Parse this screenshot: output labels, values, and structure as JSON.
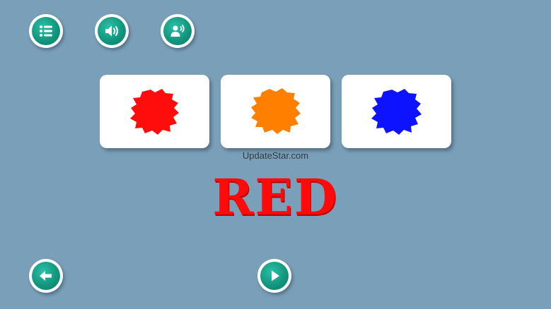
{
  "toolbar": {
    "menu_icon": "list-menu-icon",
    "sound_icon": "speaker-volume-icon",
    "voice_icon": "person-speaking-icon"
  },
  "cards": [
    {
      "color": "#ff0d0d"
    },
    {
      "color": "#ff8000"
    },
    {
      "color": "#0d12ff"
    }
  ],
  "watermark": "UpdateStar.com",
  "current_word": {
    "text": "RED",
    "color": "#ff0a0a"
  },
  "footer": {
    "back_icon": "arrow-left-icon",
    "next_icon": "play-triangle-icon"
  },
  "theme": {
    "background": "#7a9fb8",
    "button_color": "#12977f"
  }
}
